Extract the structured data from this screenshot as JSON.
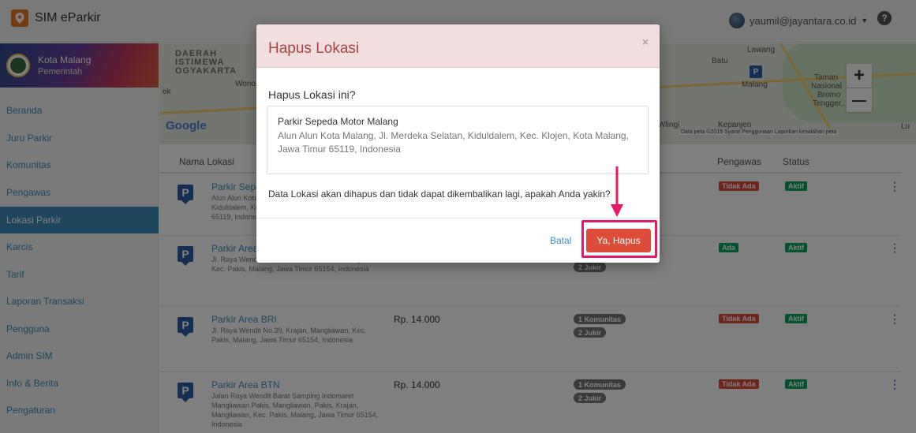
{
  "app": {
    "title": "SIM eParkir",
    "user_email": "yaumil@jayantara.co.id",
    "help_icon": "question-circle-icon"
  },
  "profile": {
    "name": "Kota Malang",
    "role": "Pemerintah"
  },
  "sidebar": {
    "items": [
      {
        "label": "Beranda"
      },
      {
        "label": "Juru Parkir"
      },
      {
        "label": "Komunitas"
      },
      {
        "label": "Pengawas"
      },
      {
        "label": "Lokasi Parkir",
        "active": true
      },
      {
        "label": "Karcis"
      },
      {
        "label": "Tarif"
      },
      {
        "label": "Laporan Transaksi"
      },
      {
        "label": "Pengguna"
      },
      {
        "label": "Admin SIM"
      },
      {
        "label": "Info & Berita"
      },
      {
        "label": "Pengaturan"
      }
    ]
  },
  "map": {
    "region_line1": "DAERAH",
    "region_line2": "ISTIMEWA",
    "region_line3": "OGYAKARTA",
    "label_wono": "Wono",
    "label_ek": "ek",
    "label_lawang": "Lawang",
    "label_batu": "Batu",
    "label_malang": "Malang",
    "label_taman": "Taman",
    "label_nasional": "Nasional",
    "label_bromo": "Bromo",
    "label_tengger": "Tengger..",
    "label_wlingi": "Wlingi",
    "label_kepanjen": "Kepanjen",
    "label_lu": "Lu",
    "google": "Google",
    "attribution": "Data peta ©2019   Syarat Penggunaan   Laporkan kesalahan peta",
    "zoom_in": "+",
    "zoom_out": "—",
    "pin": "P"
  },
  "table": {
    "headers": {
      "name": "Nama Lokasi",
      "supervisor": "Pengawas",
      "status": "Status"
    },
    "rows": [
      {
        "name": "Parkir Sepeda Motor Malang",
        "address": "Alun Alun Kota Malang, Jl. Merdeka Selatan, Kiduldalem, Kec. Klojen, Kota Malang, Jawa Timur 65119, Indonesia",
        "price": "",
        "communities": "",
        "jukir": "",
        "supervisor": "Tidak Ada",
        "status": "Aktif"
      },
      {
        "name": "Parkir Area",
        "address": "Jl. Raya Wendit Barat No.34, Lowoksoro, Mangliawan, Kec. Pakis, Malang, Jawa Timur 65154, Indonesia",
        "price": "",
        "communities": "",
        "jukir": "2 Jukir",
        "supervisor": "Ada",
        "status": "Aktif"
      },
      {
        "name": "Parkir Area BRI",
        "address": "Jl. Raya Wendit No.39, Krajan, Mangliawan, Kec. Pakis, Malang, Jawa Timur 65154, Indonesia",
        "price": "Rp. 14.000",
        "communities": "1 Komunitas",
        "jukir": "2 Jukir",
        "supervisor": "Tidak Ada",
        "status": "Aktif"
      },
      {
        "name": "Parkir Area BTN",
        "address": "Jalan Raya Wendit Barat Samping Indomaret Mangliawan Pakis, Mangliawan, Pakis, Krajan, Mangliawan, Kec. Pakis, Malang, Jawa Timur 65154, Indonesia",
        "price": "Rp. 14.000",
        "communities": "1 Komunitas",
        "jukir": "2 Jukir",
        "supervisor": "Tidak Ada",
        "status": "Aktif"
      }
    ]
  },
  "modal": {
    "title": "Hapus Lokasi",
    "close": "×",
    "question": "Hapus Lokasi ini?",
    "location_name": "Parkir Sepeda Motor Malang",
    "location_address": "Alun Alun Kota Malang, Jl. Merdeka Selatan, Kiduldalem, Kec. Klojen, Kota Malang, Jawa Timur 65119, Indonesia",
    "warning": "Data Lokasi akan dihapus dan tidak dapat dikembalikan lagi, apakah Anda yakin?",
    "cancel_label": "Batal",
    "confirm_label": "Ya, Hapus"
  },
  "colors": {
    "primary": "#3c8dbc",
    "danger": "#dd4b39",
    "success": "#00a65a",
    "annotation": "#e8176a",
    "modal_header_bg": "#f2dede"
  }
}
